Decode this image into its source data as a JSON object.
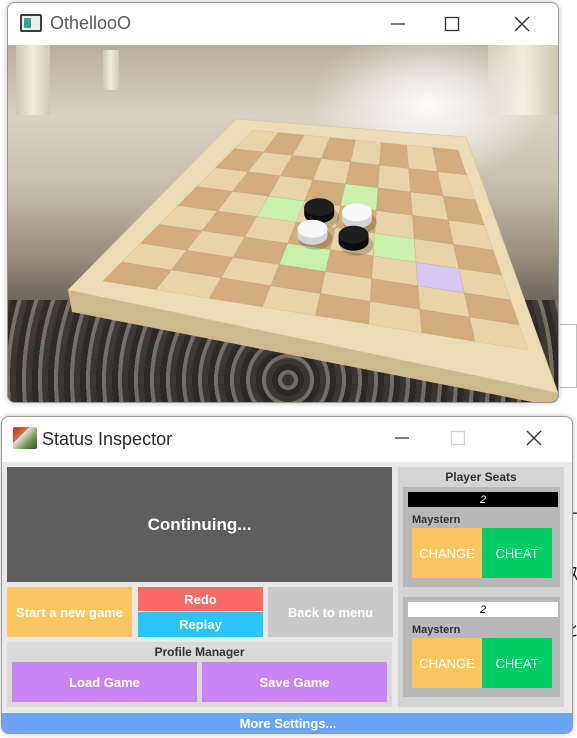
{
  "game_window": {
    "title": "OthellooO",
    "board": {
      "size": 8,
      "colors": {
        "light_square": "#e8d4a6",
        "dark_square": "#d1ad7c",
        "frame": "#ebdcb6",
        "hint": "#c8f0a8",
        "selected": "#d8c8f4"
      },
      "pieces": [
        {
          "row": 3,
          "col": 3,
          "color": "black"
        },
        {
          "row": 3,
          "col": 4,
          "color": "white"
        },
        {
          "row": 4,
          "col": 3,
          "color": "white"
        },
        {
          "row": 4,
          "col": 4,
          "color": "black"
        }
      ],
      "hints": [
        {
          "row": 2,
          "col": 4
        },
        {
          "row": 3,
          "col": 2
        },
        {
          "row": 4,
          "col": 5
        },
        {
          "row": 5,
          "col": 3
        }
      ],
      "selected": {
        "row": 5,
        "col": 6
      }
    }
  },
  "status_window": {
    "title": "Status Inspector",
    "status_text": "Continuing...",
    "buttons": {
      "start": "Start a new game",
      "redo": "Redo",
      "replay": "Replay",
      "back": "Back to menu"
    },
    "profile_manager": {
      "title": "Profile Manager",
      "load": "Load Game",
      "save": "Save Game"
    },
    "player_seats": {
      "title": "Player Seats",
      "seats": [
        {
          "score": "2",
          "color": "black",
          "name": "Maystern",
          "change": "CHANGE",
          "cheat": "CHEAT"
        },
        {
          "score": "2",
          "color": "white",
          "name": "Maystern",
          "change": "CHANGE",
          "cheat": "CHEAT"
        }
      ]
    },
    "more_settings": "More Settings..."
  },
  "colors": {
    "yellow": "#fdc55f",
    "red": "#fc6a67",
    "cyan": "#2ac7f6",
    "gray": "#c9c9c9",
    "purple": "#c985f3",
    "green": "#00cc66",
    "blue": "#6aa4f3"
  }
}
